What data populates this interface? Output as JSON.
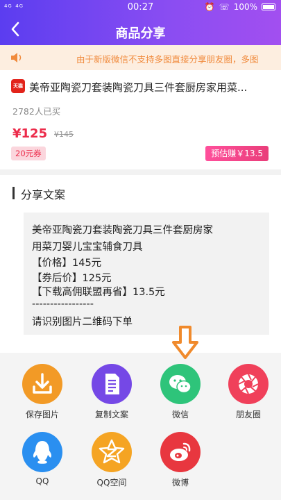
{
  "status_bar": {
    "left": "⁴ᴳ ⁴ᴳ",
    "time": "00:27",
    "battery": "100%"
  },
  "header": {
    "title": "商品分享",
    "back_glyph": "‹"
  },
  "notice": {
    "text": "由于新版微信不支持多图直接分享朋友圈，多图"
  },
  "product": {
    "badge": "天猫",
    "title": "美帝亚陶瓷刀套装陶瓷刀具三件套厨房家用菜...",
    "sold": "2782人已买",
    "price": "¥125",
    "old_price": "¥145",
    "coupon": "20元券",
    "earn": "预估赚￥13.5"
  },
  "share_copy": {
    "section_title": "分享文案",
    "lines": [
      "美帝亚陶瓷刀套装陶瓷刀具三件套厨房家",
      "用菜刀婴儿宝宝辅食刀具",
      "【价格】145元",
      "【券后价】125元",
      "【下载高佣联盟再省】13.5元",
      "-----------------",
      "请识别图片二维码下单"
    ]
  },
  "share_options": [
    {
      "label": "保存图片",
      "icon": "download-icon",
      "color": "#f29a26"
    },
    {
      "label": "复制文案",
      "icon": "document-icon",
      "color": "#7548e6"
    },
    {
      "label": "微信",
      "icon": "wechat-icon",
      "color": "#2ec47a"
    },
    {
      "label": "朋友圈",
      "icon": "moments-icon",
      "color": "#f0405a"
    },
    {
      "label": "QQ",
      "icon": "qq-icon",
      "color": "#2a8ff0"
    },
    {
      "label": "QQ空间",
      "icon": "qzone-icon",
      "color": "#f5a423"
    },
    {
      "label": "微博",
      "icon": "weibo-icon",
      "color": "#e8373f"
    }
  ]
}
